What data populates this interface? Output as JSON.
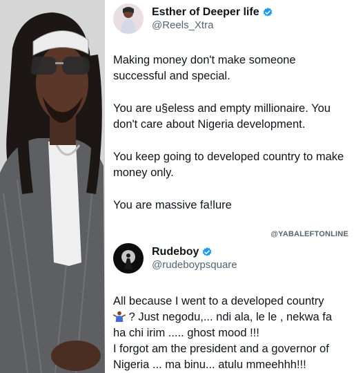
{
  "tweet": {
    "display_name": "Esther of Deeper life",
    "handle": "@Reels_Xtra",
    "paragraphs": [
      "Making money don't make someone successful and special.",
      "You are u§eless and empty millionaire. You don't care about Nigeria development.",
      "You keep going to developed country to make money only.",
      "You are massive fa!lure"
    ]
  },
  "watermark": "@YABALEFTONLINE",
  "reply": {
    "display_name": "Rudeboy",
    "handle": "@rudeboypsquare",
    "line1": "All because I went to a developed country",
    "line2": "? Just negodu,... ndi ala, le le , nekwa fa",
    "line3": "ha chi irim ..... ghost mood !!!",
    "line4": "I forgot am the president and a governor of",
    "line5": "Nigeria ... ma binu... atulu mmeehhh!!!"
  },
  "colors": {
    "verified": "#1d9bf0",
    "handle": "#536471",
    "text": "#0f1419"
  },
  "icons": {
    "verified": "verified-badge-icon",
    "emoji": "person-shrugging-emoji"
  }
}
